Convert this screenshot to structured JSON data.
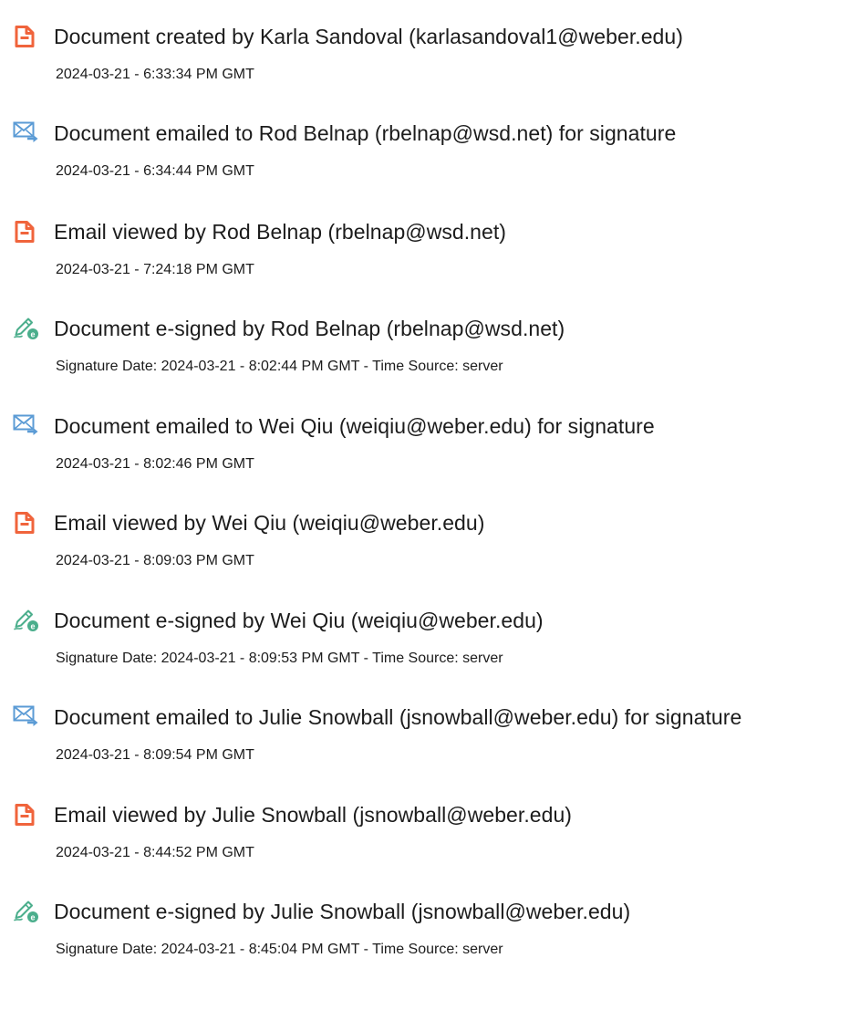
{
  "colors": {
    "document_icon": "#F0643C",
    "email_icon": "#5B9BD5",
    "signed_icon": "#4BAE8C",
    "text": "#1C1C1C"
  },
  "events": [
    {
      "icon": "document-icon",
      "description": "Document created by Karla Sandoval (karlasandoval1@weber.edu)",
      "timestamp": "2024-03-21 - 6:33:34 PM GMT"
    },
    {
      "icon": "email-sent-icon",
      "description": "Document emailed to Rod Belnap (rbelnap@wsd.net) for signature",
      "timestamp": "2024-03-21 - 6:34:44 PM GMT"
    },
    {
      "icon": "document-icon",
      "description": "Email viewed by Rod Belnap (rbelnap@wsd.net)",
      "timestamp": "2024-03-21 - 7:24:18 PM GMT"
    },
    {
      "icon": "esign-icon",
      "description": "Document e-signed by Rod Belnap (rbelnap@wsd.net)",
      "timestamp": "Signature Date: 2024-03-21 - 8:02:44 PM GMT - Time Source: server"
    },
    {
      "icon": "email-sent-icon",
      "description": "Document emailed to Wei Qiu (weiqiu@weber.edu) for signature",
      "timestamp": "2024-03-21 - 8:02:46 PM GMT"
    },
    {
      "icon": "document-icon",
      "description": "Email viewed by Wei Qiu (weiqiu@weber.edu)",
      "timestamp": "2024-03-21 - 8:09:03 PM GMT"
    },
    {
      "icon": "esign-icon",
      "description": "Document e-signed by Wei Qiu (weiqiu@weber.edu)",
      "timestamp": "Signature Date: 2024-03-21 - 8:09:53 PM GMT - Time Source: server"
    },
    {
      "icon": "email-sent-icon",
      "description": "Document emailed to Julie Snowball (jsnowball@weber.edu) for signature",
      "timestamp": "2024-03-21 - 8:09:54 PM GMT"
    },
    {
      "icon": "document-icon",
      "description": "Email viewed by Julie Snowball (jsnowball@weber.edu)",
      "timestamp": "2024-03-21 - 8:44:52 PM GMT"
    },
    {
      "icon": "esign-icon",
      "description": "Document e-signed by Julie Snowball (jsnowball@weber.edu)",
      "timestamp": "Signature Date: 2024-03-21 - 8:45:04 PM GMT - Time Source: server"
    }
  ]
}
